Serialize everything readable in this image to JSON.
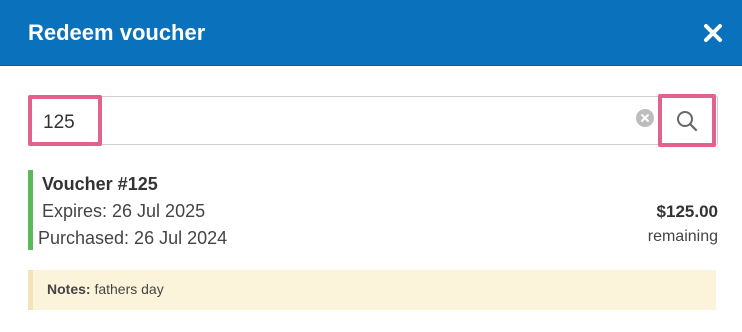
{
  "dialog": {
    "title": "Redeem voucher",
    "close_icon": "close-icon",
    "header_color": "#0a72bd"
  },
  "search": {
    "value": "125",
    "placeholder": "",
    "clear_icon": "clear-circle-icon",
    "search_icon": "magnifier-icon",
    "highlight_color": "#e0628e"
  },
  "voucher": {
    "title": "Voucher #125",
    "expires": "Expires: 26 Jul 2025",
    "purchased": "Purchased: 26 Jul 2024",
    "amount": "$125.00",
    "remaining_label": "remaining",
    "status_color": "#5cb85c"
  },
  "notes": {
    "label": "Notes:",
    "text": "fathers day"
  }
}
